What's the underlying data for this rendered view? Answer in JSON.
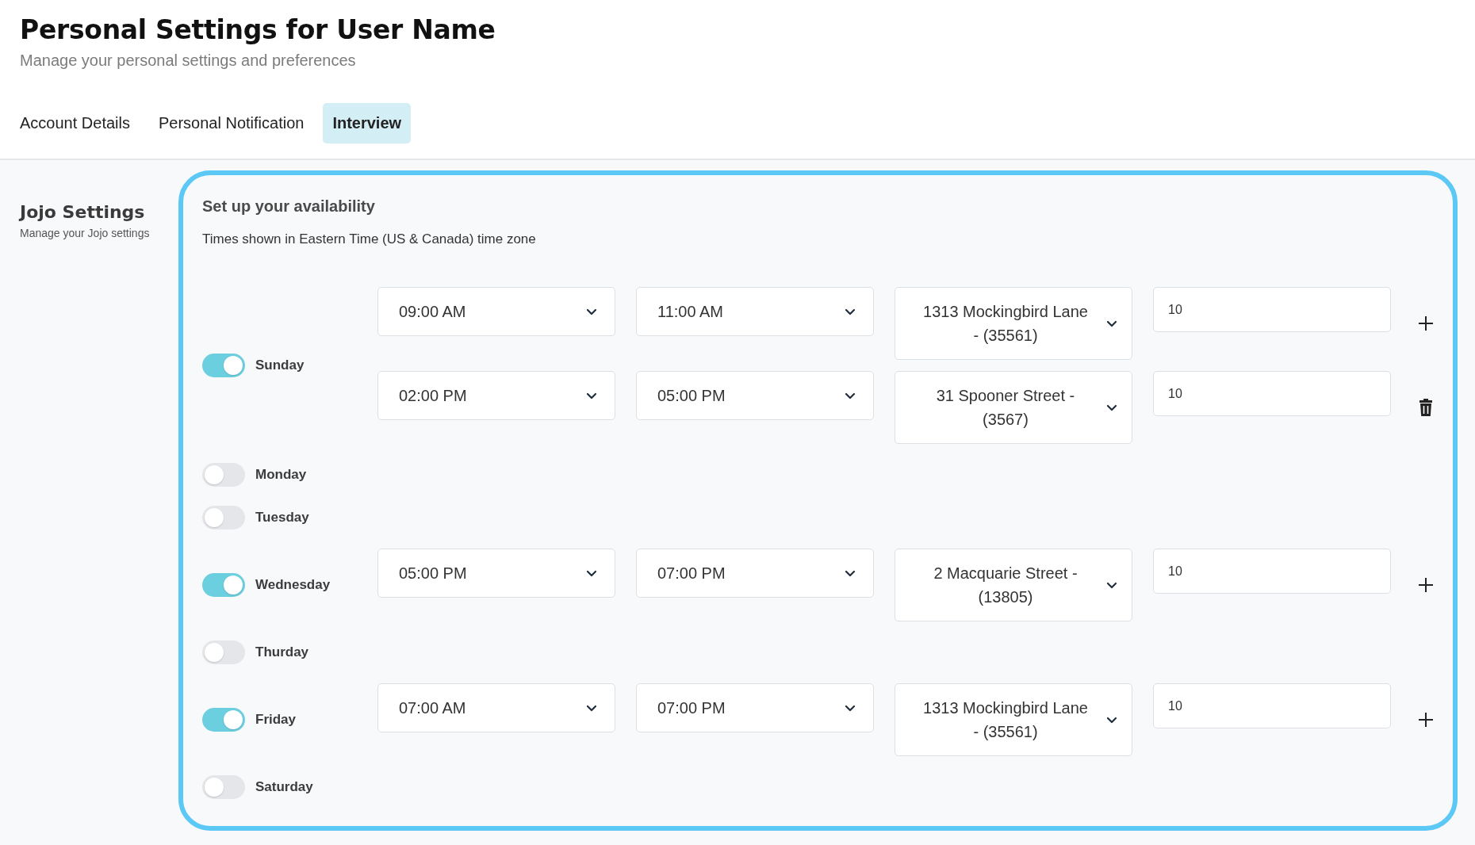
{
  "header": {
    "title": "Personal Settings for User Name",
    "subtitle": "Manage your personal settings and preferences"
  },
  "tabs": [
    {
      "label": "Account Details",
      "selected": false
    },
    {
      "label": "Personal Notification",
      "selected": false
    },
    {
      "label": "Interview",
      "selected": true
    }
  ],
  "sidebar": {
    "title": "Jojo Settings",
    "subtitle": "Manage your Jojo settings"
  },
  "availability": {
    "title": "Set up your availability",
    "note": "Times shown in Eastern Time (US & Canada) time zone",
    "days": [
      {
        "name": "Sunday",
        "enabled": true,
        "slots": [
          {
            "start": "09:00 AM",
            "end": "11:00 AM",
            "location": "1313 Mockingbird Lane - (35561)",
            "count": "10",
            "kind": "add"
          },
          {
            "start": "02:00 PM",
            "end": "05:00 PM",
            "location": "31 Spooner Street - (3567)",
            "count": "10",
            "kind": "delete"
          }
        ]
      },
      {
        "name": "Monday",
        "enabled": false
      },
      {
        "name": "Tuesday",
        "enabled": false
      },
      {
        "name": "Wednesday",
        "enabled": true,
        "slots": [
          {
            "start": "05:00 PM",
            "end": "07:00 PM",
            "location": "2 Macquarie Street - (13805)",
            "count": "10",
            "kind": "add"
          }
        ]
      },
      {
        "name": "Thurday",
        "enabled": false
      },
      {
        "name": "Friday",
        "enabled": true,
        "slots": [
          {
            "start": "07:00 AM",
            "end": "07:00 PM",
            "location": "1313 Mockingbird Lane - (35561)",
            "count": "10",
            "kind": "add"
          }
        ]
      },
      {
        "name": "Saturday",
        "enabled": false
      }
    ]
  }
}
